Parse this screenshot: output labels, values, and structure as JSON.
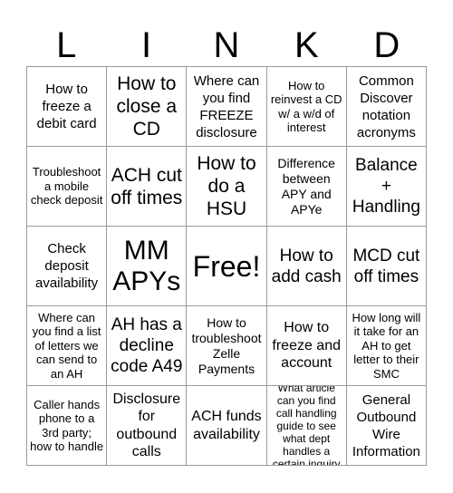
{
  "title_letters": [
    "L",
    "I",
    "N",
    "K",
    "D"
  ],
  "cells": [
    [
      "How to freeze a debit card",
      "How to close a CD",
      "Where can you find FREEZE disclosure",
      "How to reinvest a CD w/ a w/d of interest",
      "Common Discover notation acronyms"
    ],
    [
      "Troubleshoot a mobile check deposit",
      "ACH cut off times",
      "How to do a HSU",
      "Difference between APY and APYe",
      "Balance + Handling"
    ],
    [
      "Check deposit availability",
      "MM APYs",
      "Free!",
      "How to add cash",
      "MCD cut off times"
    ],
    [
      "Where can you find a list of letters we can send to an AH",
      "AH has a decline code A49",
      "How to troubleshoot Zelle Payments",
      "How to freeze and account",
      "How long will it take for an AH to get letter to their SMC"
    ],
    [
      "Caller hands phone to a 3rd party; how to handle",
      "Disclosure for outbound calls",
      "ACH funds availability",
      "What article can you find call handling guide to see what dept handles a certain inquiry",
      "General Outbound Wire Information"
    ]
  ],
  "free_space": {
    "row": 2,
    "col": 2,
    "label": "Free!"
  },
  "colors": {
    "grid_line": "#9a9a9a",
    "text": "#000000",
    "background": "#ffffff"
  }
}
